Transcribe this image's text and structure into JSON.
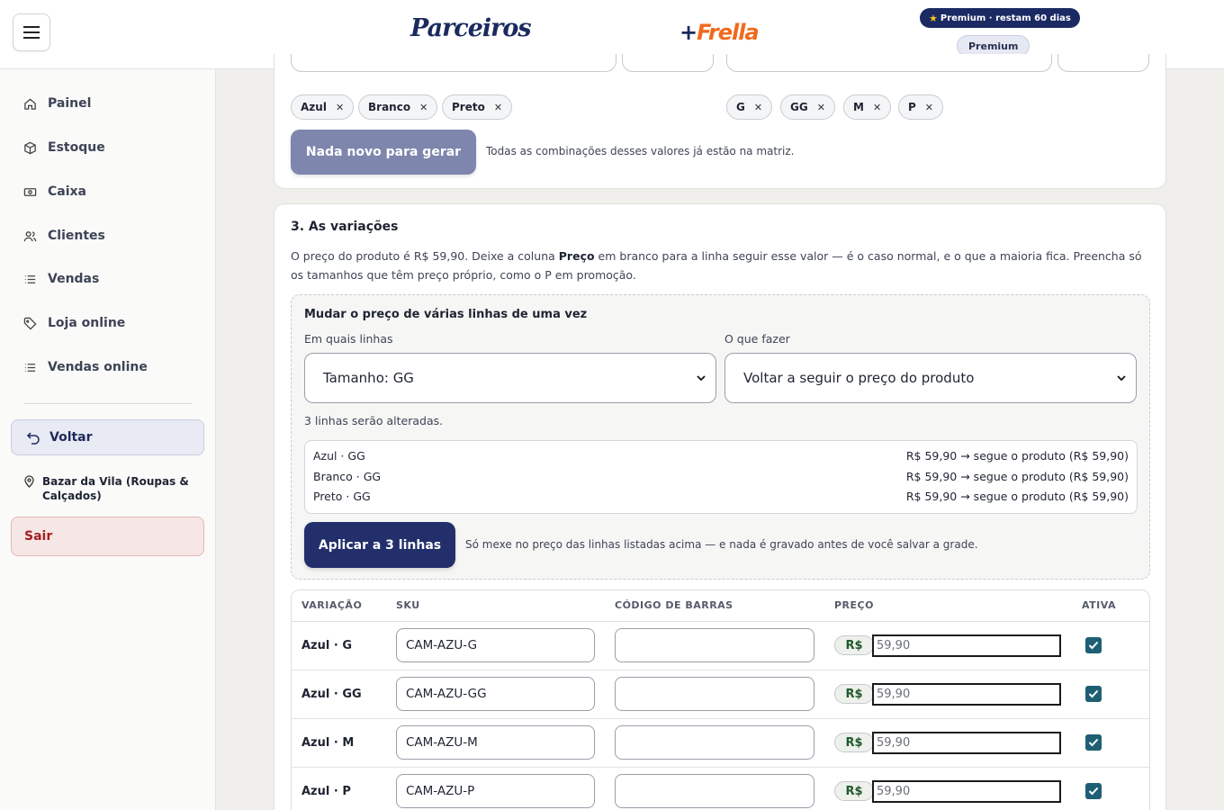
{
  "header": {
    "logo_left": "Parceiros",
    "logo_right_plus": "+",
    "logo_right": "Frella",
    "premium_pill": "Premium · restam 60 dias",
    "premium_badge": "Premium"
  },
  "sidebar": {
    "items": [
      {
        "label": "Painel",
        "icon": "home-icon"
      },
      {
        "label": "Estoque",
        "icon": "box-icon"
      },
      {
        "label": "Caixa",
        "icon": "cash-icon"
      },
      {
        "label": "Clientes",
        "icon": "users-icon"
      },
      {
        "label": "Vendas",
        "icon": "list-icon"
      },
      {
        "label": "Loja online",
        "icon": "tag-icon"
      },
      {
        "label": "Vendas online",
        "icon": "list-icon"
      }
    ],
    "back_label": "Voltar",
    "store_name": "Bazar da Vila (Roupas & Calçados)",
    "logout_label": "Sair"
  },
  "attributes": {
    "colors": [
      "Azul",
      "Branco",
      "Preto"
    ],
    "sizes": [
      "G",
      "GG",
      "M",
      "P"
    ],
    "generate_label": "Nada novo para gerar",
    "generate_note": "Todas as combinações desses valores já estão na matriz."
  },
  "variations": {
    "title": "3. As variações",
    "desc_1": "O preço do produto é R$ 59,90. Deixe a coluna ",
    "desc_bold": "Preço",
    "desc_2": " em branco para a linha seguir esse valor — é o caso normal, e o que a maioria fica. Preencha só os tamanhos que têm preço próprio, como o P em promoção.",
    "bulk": {
      "title": "Mudar o preço de várias linhas de uma vez",
      "rows_label": "Em quais linhas",
      "rows_value": "Tamanho: GG",
      "action_label": "O que fazer",
      "action_value": "Voltar a seguir o preço do produto",
      "count_note": "3 linhas serão alteradas.",
      "preview": [
        {
          "name": "Azul · GG",
          "change": "R$ 59,90 → segue o produto (R$ 59,90)"
        },
        {
          "name": "Branco · GG",
          "change": "R$ 59,90 → segue o produto (R$ 59,90)"
        },
        {
          "name": "Preto · GG",
          "change": "R$ 59,90 → segue o produto (R$ 59,90)"
        }
      ],
      "apply_label": "Aplicar a 3 linhas",
      "apply_note": "Só mexe no preço das linhas listadas acima — e nada é gravado antes de você salvar a grade."
    },
    "table": {
      "headers": {
        "variation": "VARIAÇÃO",
        "sku": "SKU",
        "barcode": "CÓDIGO DE BARRAS",
        "price": "PREÇO",
        "active": "ATIVA"
      },
      "currency": "R$",
      "rows": [
        {
          "name": "Azul · G",
          "sku": "CAM-AZU-G",
          "barcode": "",
          "price_placeholder": "59,90",
          "active": true
        },
        {
          "name": "Azul · GG",
          "sku": "CAM-AZU-GG",
          "barcode": "",
          "price_placeholder": "59,90",
          "active": true
        },
        {
          "name": "Azul · M",
          "sku": "CAM-AZU-M",
          "barcode": "",
          "price_placeholder": "59,90",
          "active": true
        },
        {
          "name": "Azul · P",
          "sku": "CAM-AZU-P",
          "barcode": "",
          "price_placeholder": "59,90",
          "active": true
        }
      ]
    }
  },
  "colors": {
    "brand_navy": "#1c2a63",
    "brand_orange": "#f06a1d",
    "logout_red": "#a32020",
    "checkbox": "#1f5f73"
  }
}
